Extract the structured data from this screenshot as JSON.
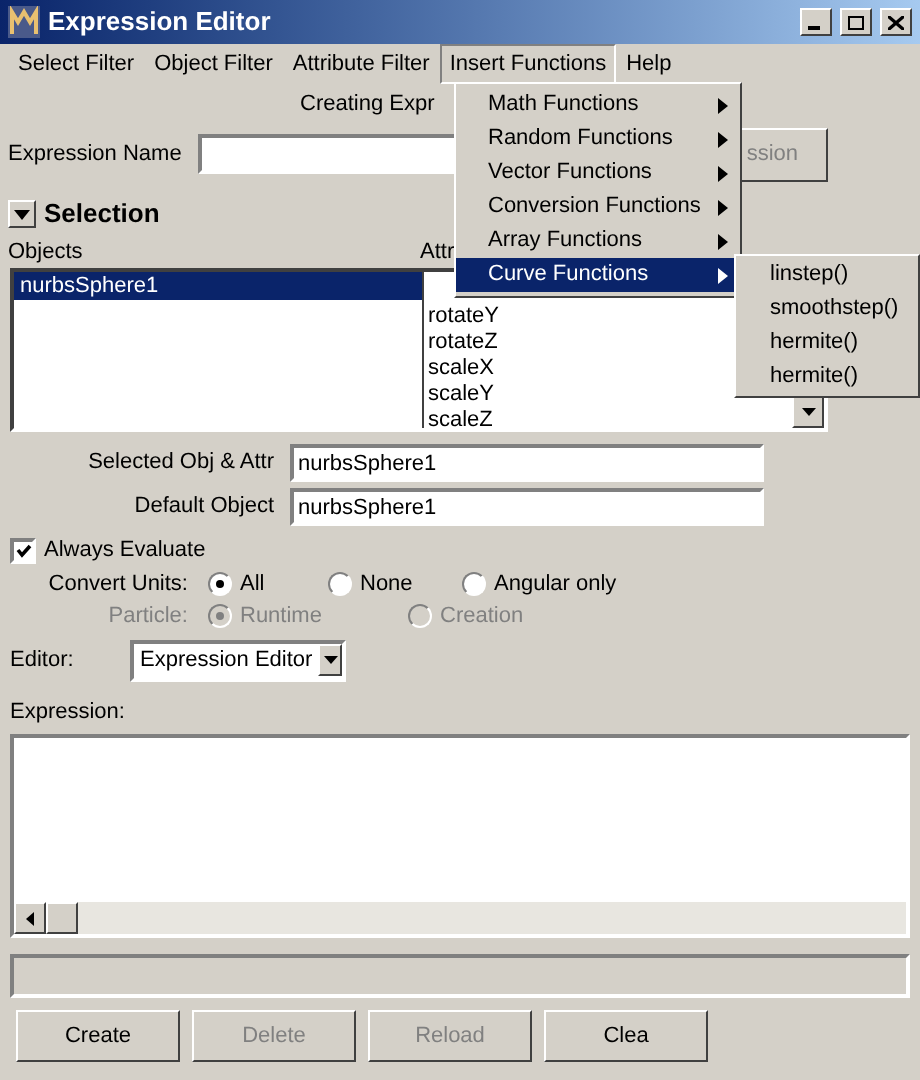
{
  "window": {
    "title": "Expression Editor"
  },
  "menu_bar": [
    {
      "label": "Select Filter",
      "selected": false
    },
    {
      "label": "Object Filter",
      "selected": false
    },
    {
      "label": "Attribute Filter",
      "selected": false
    },
    {
      "label": "Insert Functions",
      "selected": true
    },
    {
      "label": "Help",
      "selected": false
    }
  ],
  "header": "Creating Expr",
  "expression_name": {
    "label": "Expression Name",
    "button": "ssion"
  },
  "selection": {
    "title": "Selection",
    "expanded": true,
    "objects_label": "Objects",
    "attributes_label": "Attr",
    "objects": [
      {
        "label": "nurbsSphere1",
        "selected": true
      }
    ],
    "attributes": [
      {
        "label": "rotateY",
        "selected": false
      },
      {
        "label": "rotateZ",
        "selected": false
      },
      {
        "label": "scaleX",
        "selected": false
      },
      {
        "label": "scaleY",
        "selected": false
      },
      {
        "label": "scaleZ",
        "selected": false
      }
    ]
  },
  "fields": [
    {
      "label": "Selected Obj & Attr",
      "value": "nurbsSphere1"
    },
    {
      "label": "Default Object",
      "value": "nurbsSphere1"
    }
  ],
  "always_evaluate": {
    "label": "Always Evaluate",
    "checked": true
  },
  "convert_units": {
    "label": "Convert Units:",
    "disabled": false,
    "options": [
      {
        "label": "All",
        "selected": true
      },
      {
        "label": "None",
        "selected": false
      },
      {
        "label": "Angular only",
        "selected": false
      }
    ]
  },
  "particle": {
    "label": "Particle:",
    "disabled": true,
    "options": [
      {
        "label": "Runtime",
        "selected": true
      },
      {
        "label": "Creation",
        "selected": false
      }
    ]
  },
  "editor": {
    "label": "Editor:",
    "value": "Expression Editor"
  },
  "expression": {
    "label": "Expression:"
  },
  "buttons": [
    {
      "label": "Create",
      "disabled": false
    },
    {
      "label": "Delete",
      "disabled": true
    },
    {
      "label": "Reload",
      "disabled": true
    },
    {
      "label": "Clea",
      "disabled": false
    }
  ],
  "insert_menu": [
    {
      "label": "Math Functions",
      "selected": false
    },
    {
      "label": "Random Functions",
      "selected": false
    },
    {
      "label": "Vector Functions",
      "selected": false
    },
    {
      "label": "Conversion Functions",
      "selected": false
    },
    {
      "label": "Array Functions",
      "selected": false
    },
    {
      "label": "Curve Functions",
      "selected": true
    }
  ],
  "curve_submenu": [
    "linstep()",
    "smoothstep()",
    "hermite()",
    "hermite()"
  ]
}
